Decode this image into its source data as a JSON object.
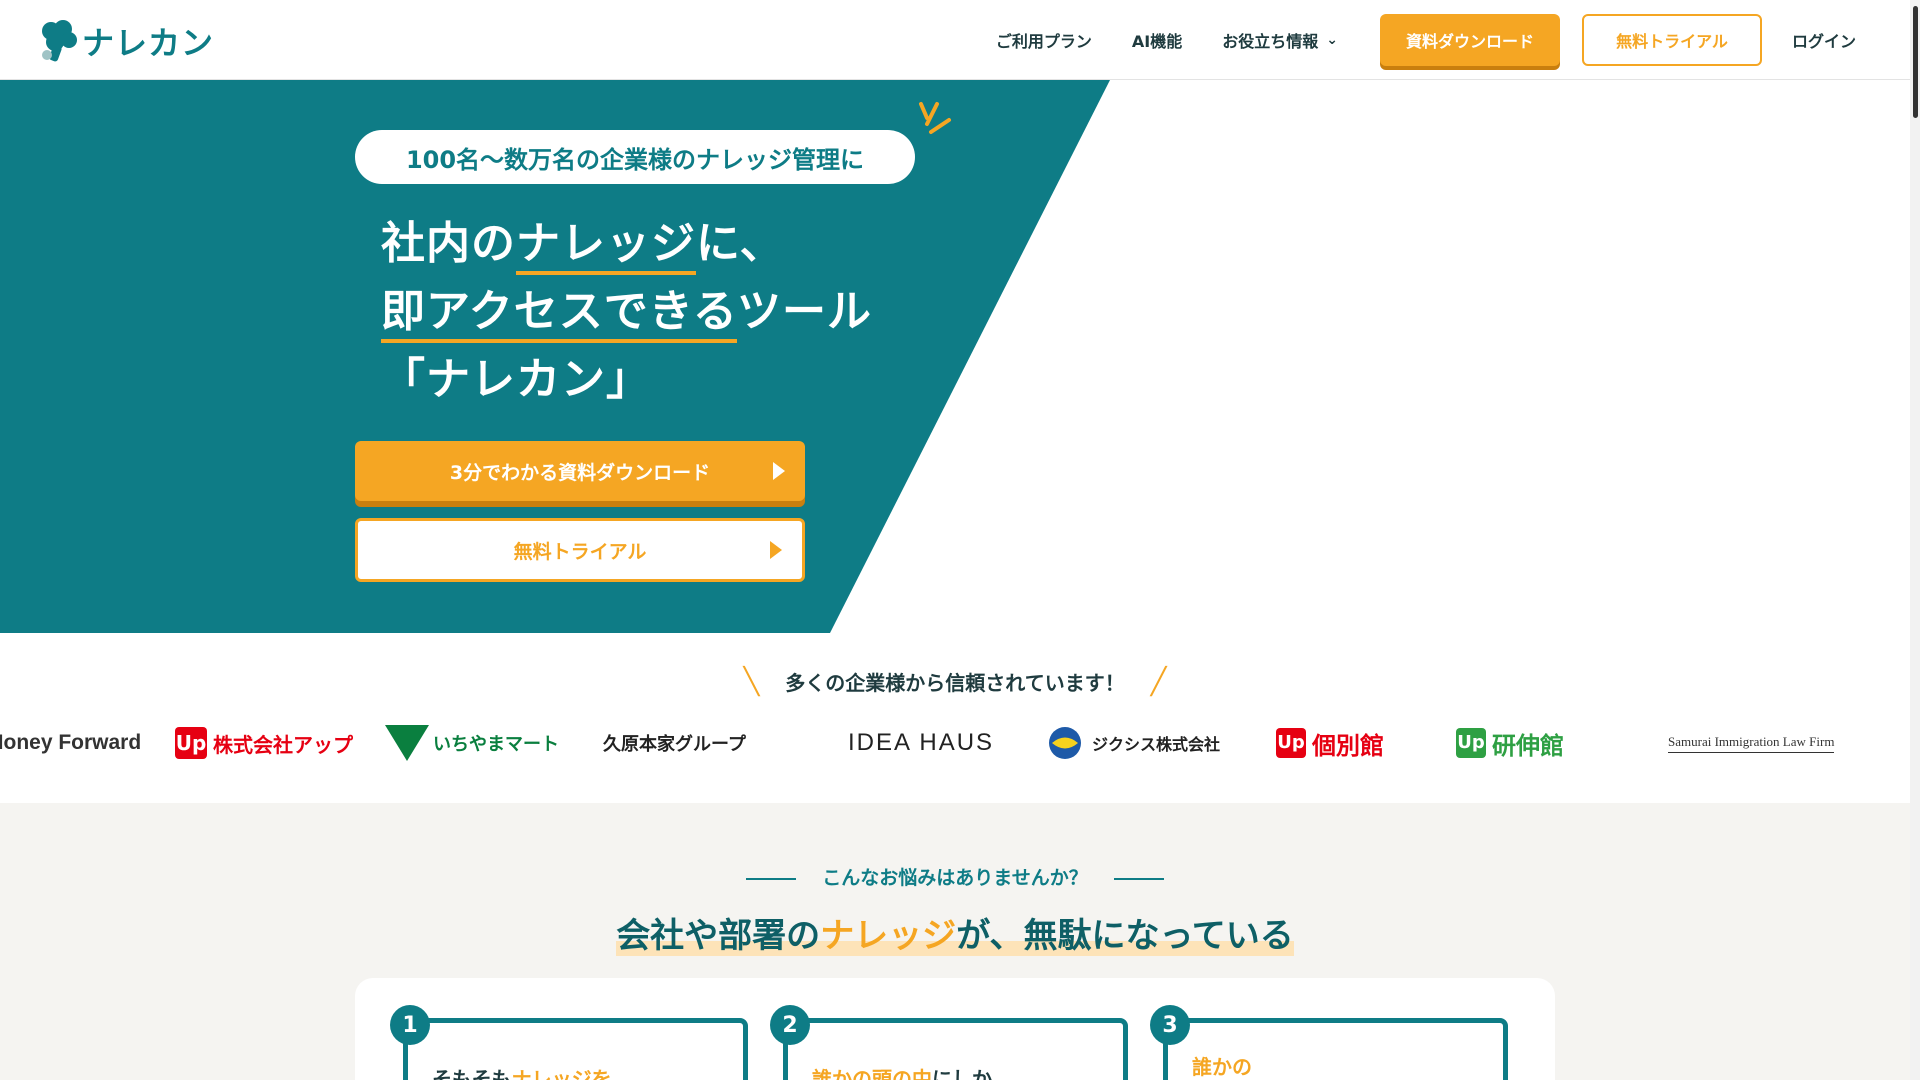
{
  "brand": {
    "name": "ナレカン",
    "teal": "#0e7c86",
    "orange": "#f5a623"
  },
  "nav": {
    "plan": "ご利用プラン",
    "ai": "AI機能",
    "useful": "お役立ち情報",
    "download": "資料ダウンロード",
    "trial": "無料トライアル",
    "login": "ログイン"
  },
  "hero": {
    "badge": "100名〜数万名の企業様のナレッジ管理に",
    "title_l1_a": "社内の",
    "title_l1_b": "ナレッジ",
    "title_l1_c": "に、",
    "title_l2_a": "即アクセスできる",
    "title_l2_b": "ツール",
    "title_l3": "「ナレカン」",
    "cta_download": "3分でわかる資料ダウンロード",
    "cta_trial": "無料トライアル"
  },
  "trust": {
    "title": "多くの企業様から信頼されています！",
    "logos": [
      "Money Forward",
      "株式会社アップ",
      "いちやまマート",
      "久原本家グループ",
      "IDEA HAUS",
      "ジクシス株式会社",
      "個別館",
      "研伸館",
      "Samurai Immigration Law Firm"
    ]
  },
  "problems": {
    "eyebrow": "こんなお悩みはありませんか？",
    "title_a": "会社や部署の",
    "title_b": "ナレッジ",
    "title_c": "が、無駄になっている",
    "cards": [
      {
        "num": "1",
        "text_a": "そもそも",
        "text_b": "ナレッジを"
      },
      {
        "num": "2",
        "text_a": "誰かの頭の中",
        "text_b": "にしか"
      },
      {
        "num": "3",
        "text_a": "",
        "text_b": "誰かの"
      }
    ]
  }
}
